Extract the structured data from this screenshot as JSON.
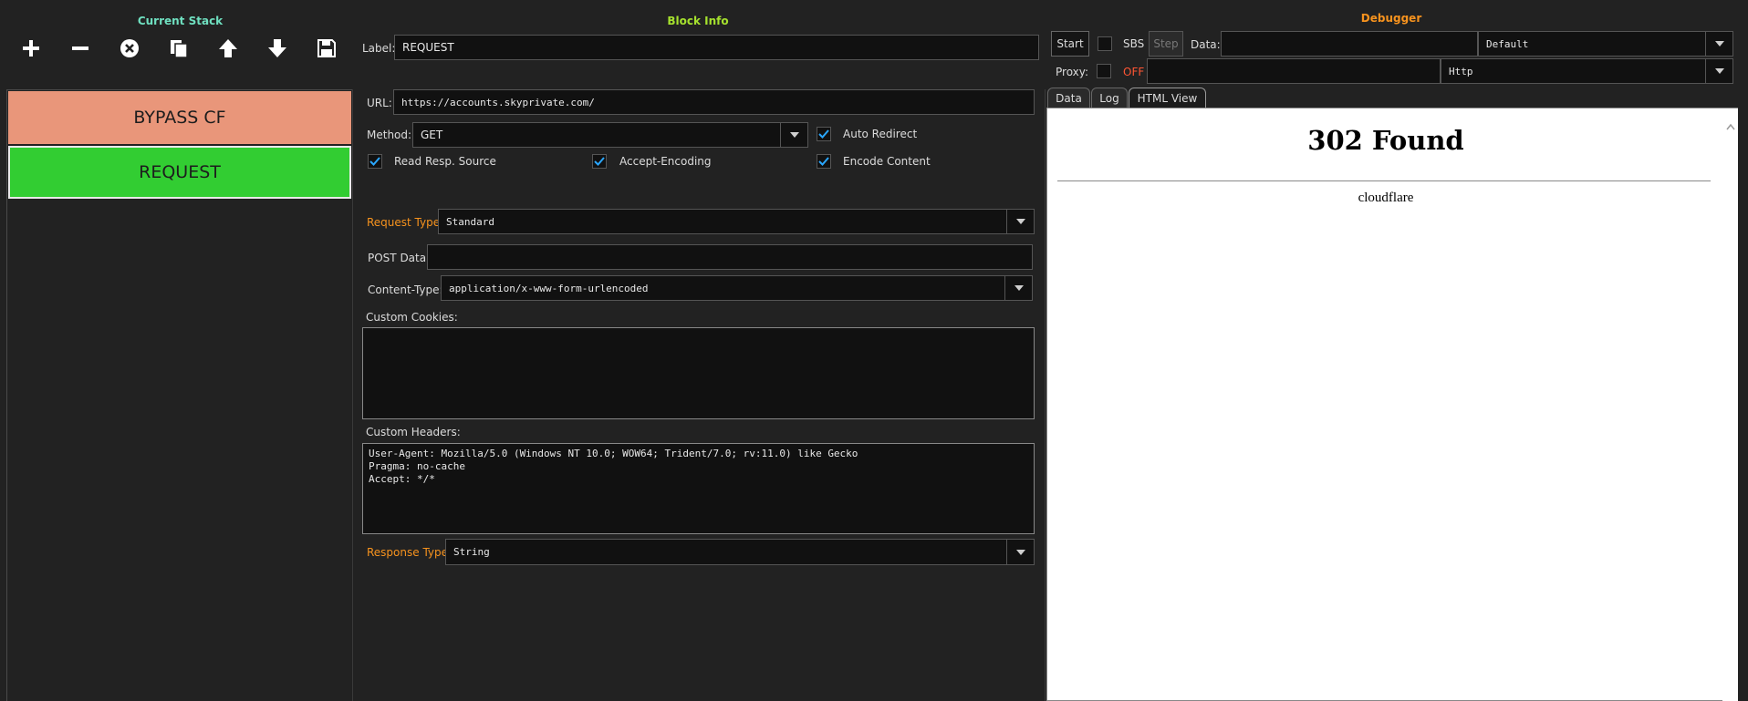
{
  "stack": {
    "title": "Current Stack",
    "blocks": [
      {
        "label": "BYPASS CF",
        "color": "#e9967a"
      },
      {
        "label": "REQUEST",
        "color": "#32cd32"
      }
    ]
  },
  "block_info": {
    "title": "Block Info",
    "label_caption": "Label:",
    "label_value": "REQUEST",
    "url_caption": "URL:",
    "url_value": "https://accounts.skyprivate.com/",
    "method_caption": "Method:",
    "method_value": "GET",
    "auto_redirect": "Auto Redirect",
    "read_resp_source": "Read Resp. Source",
    "accept_encoding": "Accept-Encoding",
    "encode_content": "Encode Content",
    "request_type_caption": "Request Type:",
    "request_type_value": "Standard",
    "post_data_caption": "POST Data:",
    "post_data_value": "",
    "content_type_caption": "Content-Type:",
    "content_type_value": "application/x-www-form-urlencoded",
    "custom_cookies_caption": "Custom Cookies:",
    "custom_cookies_value": "",
    "custom_headers_caption": "Custom Headers:",
    "custom_headers_value": "User-Agent: Mozilla/5.0 (Windows NT 10.0; WOW64; Trident/7.0; rv:11.0) like Gecko\nPragma: no-cache\nAccept: */*",
    "response_type_caption": "Response Type:",
    "response_type_value": "String"
  },
  "debugger": {
    "title": "Debugger",
    "start": "Start",
    "sbs": "SBS",
    "step": "Step",
    "data_caption": "Data:",
    "data_value": "",
    "data_combo": "Default",
    "proxy_caption": "Proxy:",
    "proxy_state": "OFF",
    "proxy_value": "",
    "proxy_combo": "Http",
    "tabs": [
      "Data",
      "Log",
      "HTML View"
    ],
    "html_view": {
      "heading": "302 Found",
      "footer": "cloudflare"
    }
  },
  "colors": {
    "stack_title": "#6fe0c0",
    "block_info_title": "#a6e22e",
    "debugger_title": "#f7931e",
    "accent_orange": "#f7931e",
    "proxy_off": "#ff5533",
    "check_blue": "#2aa7ff"
  }
}
